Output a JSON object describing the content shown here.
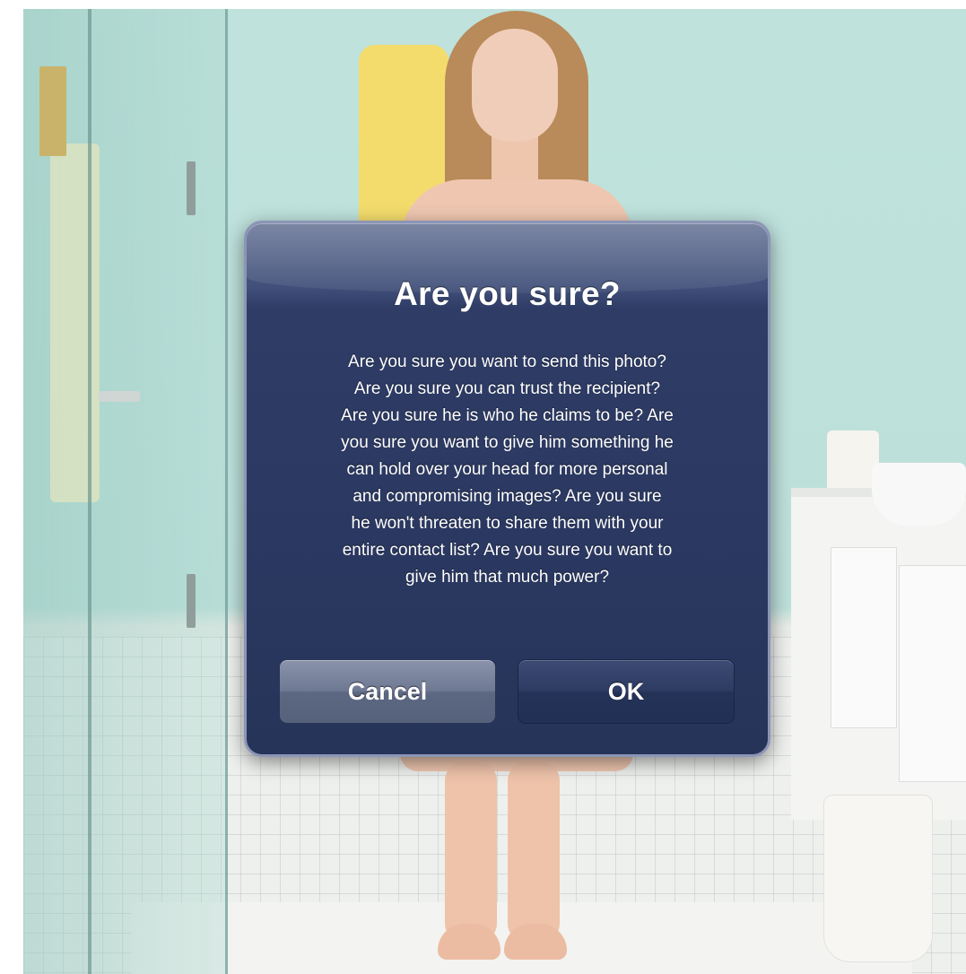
{
  "dialog": {
    "title": "Are you sure?",
    "message": "Are you sure you want to send this photo?\nAre you sure you can trust the recipient?\nAre you sure he is who he claims to be? Are\nyou sure you want to give him something he\ncan hold over your head for more personal\nand compromising images? Are you sure\nhe won't threaten to share them with your\nentire contact list? Are you sure you want to\ngive him that much power?",
    "cancel_label": "Cancel",
    "ok_label": "OK"
  },
  "colors": {
    "dialog_background": "#2b3962",
    "dialog_border": "#8b95b6",
    "cancel_button": "#6f7993",
    "ok_button": "#2e3b63",
    "wall": "#bfe2dc"
  }
}
